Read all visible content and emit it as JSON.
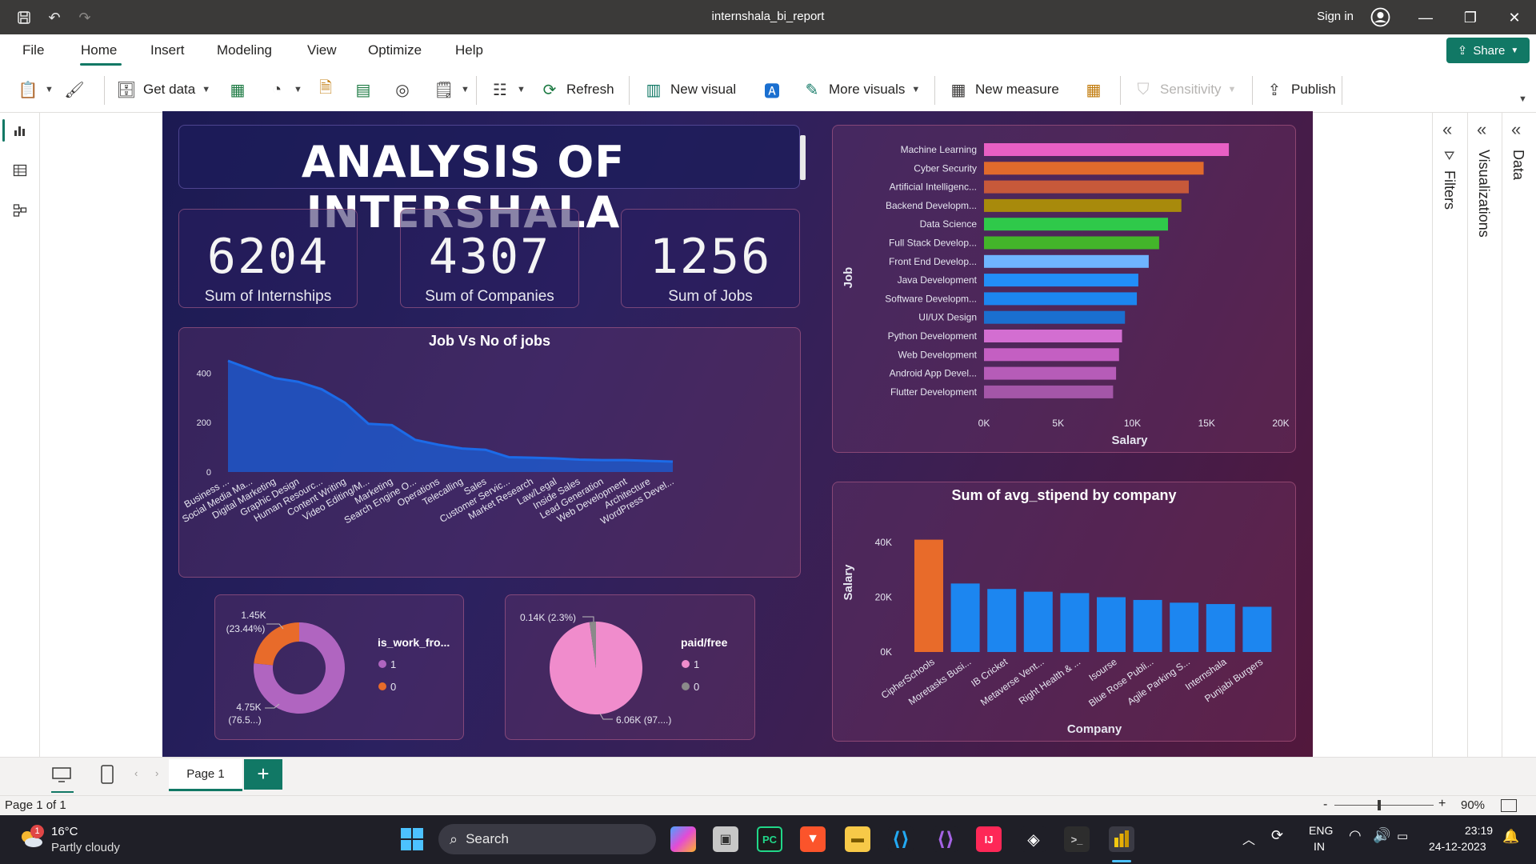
{
  "window": {
    "title": "internshala_bi_report",
    "sign_in": "Sign in"
  },
  "menu": {
    "items": [
      "File",
      "Home",
      "Insert",
      "Modeling",
      "View",
      "Optimize",
      "Help"
    ],
    "share": "Share"
  },
  "ribbon": {
    "get_data": "Get data",
    "refresh": "Refresh",
    "new_visual": "New visual",
    "more_visuals": "More visuals",
    "new_measure": "New measure",
    "sensitivity": "Sensitivity",
    "publish": "Publish"
  },
  "report": {
    "title": "ANALYSIS OF INTERSHALA",
    "kpis": [
      {
        "value": "6204",
        "label": "Sum of Internships"
      },
      {
        "value": "4307",
        "label": "Sum of Companies"
      },
      {
        "value": "1256",
        "label": "Sum of Jobs"
      }
    ],
    "donut": {
      "legend_title": "is_work_fro...",
      "legend": [
        "1",
        "0"
      ],
      "label_top_value": "1.45K",
      "label_top_pct": "(23.44%)",
      "label_bottom_value": "4.75K",
      "label_bottom_pct": "(76.5...)"
    },
    "pie": {
      "legend_title": "paid/free",
      "legend": [
        "1",
        "0"
      ],
      "label_small": "0.14K (2.3%)",
      "label_large": "6.06K (97....)"
    }
  },
  "chart_data": [
    {
      "type": "area",
      "title": "Job Vs No of jobs",
      "xlabel": "",
      "ylabel": "",
      "x": [
        "Business ...",
        "Social Media Ma...",
        "Digital Marketing",
        "Graphic Design",
        "Human Resourc...",
        "Content Writing",
        "Video Editing/M...",
        "Marketing",
        "Search Engine O...",
        "Operations",
        "Telecalling",
        "Sales",
        "Customer Servic...",
        "Market Research",
        "Law/Legal",
        "Inside Sales",
        "Lead Generation",
        "Web Development",
        "Architecture",
        "WordPress Devel..."
      ],
      "values": [
        450,
        415,
        380,
        365,
        335,
        280,
        195,
        190,
        130,
        110,
        95,
        90,
        60,
        58,
        55,
        50,
        48,
        48,
        45,
        42
      ],
      "yticks": [
        "0",
        "200",
        "400"
      ],
      "ylim": [
        0,
        460
      ],
      "color": "#1c6be8"
    },
    {
      "type": "bar",
      "orientation": "horizontal",
      "xlabel": "Salary",
      "ylabel": "Job",
      "categories": [
        "Machine Learning",
        "Cyber Security",
        "Artificial Intelligenc...",
        "Backend Developm...",
        "Data Science",
        "Full Stack Develop...",
        "Front End Develop...",
        "Java Development",
        "Software Developm...",
        "UI/UX Design",
        "Python Development",
        "Web Development",
        "Android App Devel...",
        "Flutter Development"
      ],
      "values": [
        16500,
        14800,
        13800,
        13300,
        12400,
        11800,
        11100,
        10400,
        10300,
        9500,
        9300,
        9100,
        8900,
        8700
      ],
      "colors": [
        "#e85fc4",
        "#e06a2c",
        "#c7593a",
        "#a88a0c",
        "#2fc94a",
        "#43b52a",
        "#6fb4ff",
        "#228ef8",
        "#1c86f0",
        "#1a6fd0",
        "#d36ed1",
        "#c45fc2",
        "#b65cb8",
        "#a456a8"
      ],
      "xticks": [
        "0K",
        "5K",
        "10K",
        "15K",
        "20K"
      ],
      "xlim": [
        0,
        20000
      ]
    },
    {
      "type": "bar",
      "title": "Sum of avg_stipend by company",
      "xlabel": "Company",
      "ylabel": "Salary",
      "categories": [
        "CipherSchools",
        "Moretasks Busi...",
        "IB Cricket",
        "Metaverse Vent...",
        "Right Health & ...",
        "Isourse",
        "Blue Rose Publi...",
        "Agile Parking S...",
        "Internshala",
        "Punjabi Burgers"
      ],
      "values": [
        41000,
        25000,
        23000,
        22000,
        21500,
        20000,
        19000,
        18000,
        17500,
        16500
      ],
      "colors": [
        "#e86b2a",
        "#1c86f0",
        "#1c86f0",
        "#1c86f0",
        "#1c86f0",
        "#1c86f0",
        "#1c86f0",
        "#1c86f0",
        "#1c86f0",
        "#1c86f0"
      ],
      "yticks": [
        "0K",
        "20K",
        "40K"
      ],
      "ylim": [
        0,
        44000
      ]
    },
    {
      "type": "pie",
      "variant": "donut",
      "series_title": "is_work_fro...",
      "categories": [
        "1",
        "0"
      ],
      "values": [
        4750,
        1450
      ],
      "colors": [
        "#b065c0",
        "#e86b2a"
      ]
    },
    {
      "type": "pie",
      "series_title": "paid/free",
      "categories": [
        "1",
        "0"
      ],
      "values": [
        6060,
        140
      ],
      "colors": [
        "#f08ccc",
        "#8a8a8a"
      ]
    }
  ],
  "panes": {
    "filters": "Filters",
    "visualizations": "Visualizations",
    "data": "Data"
  },
  "pages": {
    "tab": "Page 1",
    "status": "Page 1 of 1",
    "zoom": "90%"
  },
  "taskbar": {
    "weather_temp": "16°C",
    "weather_desc": "Partly cloudy",
    "weather_badge": "1",
    "search": "Search",
    "lang_top": "ENG",
    "lang_bottom": "IN",
    "time": "23:19",
    "date": "24-12-2023"
  }
}
